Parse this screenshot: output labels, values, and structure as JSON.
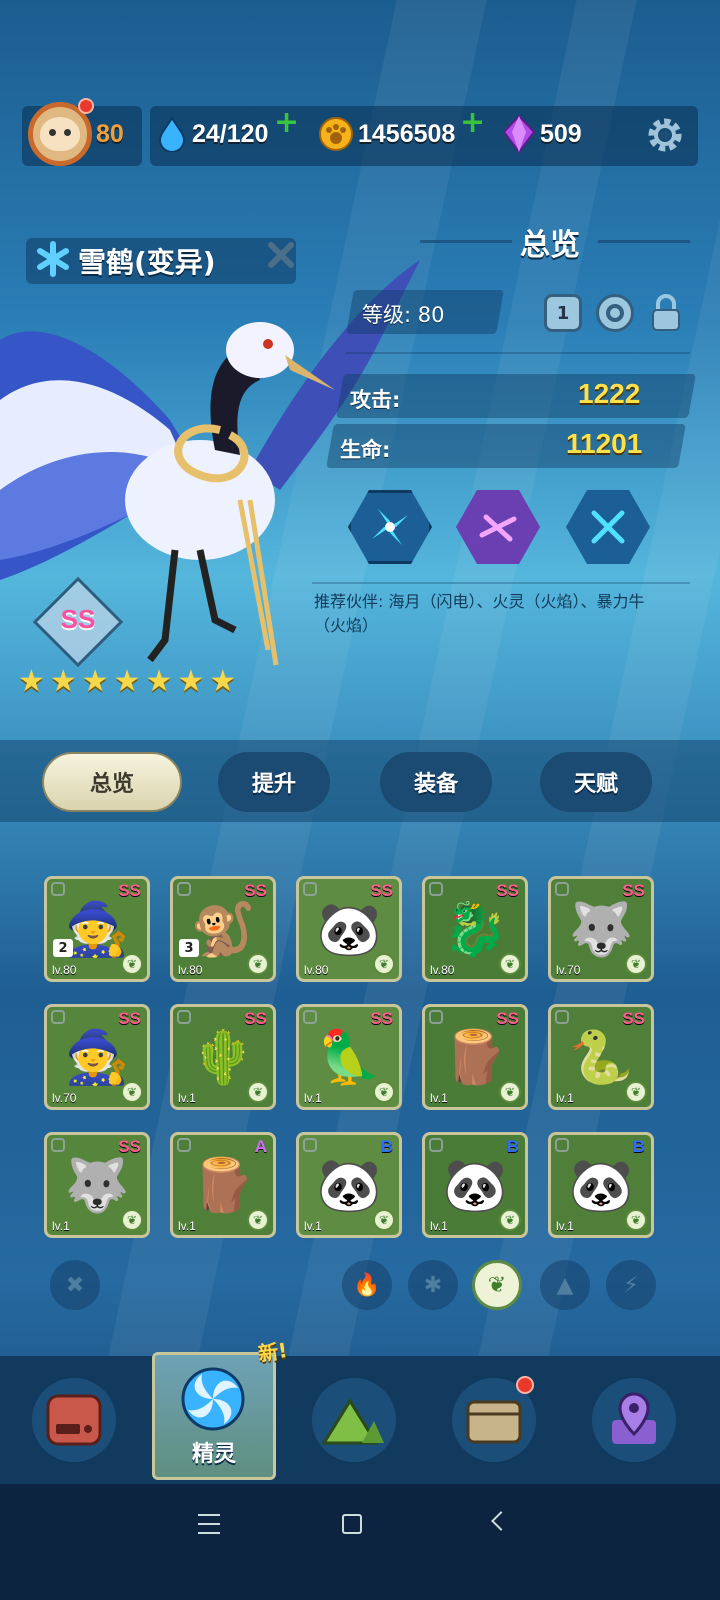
{
  "header": {
    "level": "80",
    "energy": "24/120",
    "coins": "1456508",
    "gems": "509"
  },
  "pet": {
    "name": "雪鹤(变异)",
    "rank": "SS",
    "stars": 7
  },
  "overview": {
    "title": "总览",
    "level_label": "等级: 80",
    "badge_num": "1",
    "attack_label": "攻击:",
    "attack_value": "1222",
    "hp_label": "生命:",
    "hp_value": "11201",
    "recommend": "推荐伙伴: 海月（闪电）、火灵（火焰）、暴力牛（火焰）"
  },
  "tabs": [
    "总览",
    "提升",
    "装备",
    "天赋"
  ],
  "cards": [
    {
      "rank": "SS",
      "lv": "lv.80",
      "num": "2",
      "icon": "🧙"
    },
    {
      "rank": "SS",
      "lv": "lv.80",
      "num": "3",
      "icon": "🐒"
    },
    {
      "rank": "SS",
      "lv": "lv.80",
      "num": "",
      "icon": "🐼"
    },
    {
      "rank": "SS",
      "lv": "lv.80",
      "num": "",
      "icon": "🐉"
    },
    {
      "rank": "SS",
      "lv": "lv.70",
      "num": "",
      "icon": "🐺"
    },
    {
      "rank": "SS",
      "lv": "lv.70",
      "num": "",
      "icon": "🧙"
    },
    {
      "rank": "SS",
      "lv": "lv.1",
      "num": "",
      "icon": "🌵"
    },
    {
      "rank": "SS",
      "lv": "lv.1",
      "num": "",
      "icon": "🦜"
    },
    {
      "rank": "SS",
      "lv": "lv.1",
      "num": "",
      "icon": "🪵"
    },
    {
      "rank": "SS",
      "lv": "lv.1",
      "num": "",
      "icon": "🐍"
    },
    {
      "rank": "SS",
      "lv": "lv.1",
      "num": "",
      "icon": "🐺"
    },
    {
      "rank": "A",
      "lv": "lv.1",
      "num": "",
      "icon": "🪵"
    },
    {
      "rank": "B",
      "lv": "lv.1",
      "num": "",
      "icon": "🐼"
    },
    {
      "rank": "B",
      "lv": "lv.1",
      "num": "",
      "icon": "🐼"
    },
    {
      "rank": "B",
      "lv": "lv.1",
      "num": "",
      "icon": "🐼"
    }
  ],
  "nav": {
    "active_label": "精灵",
    "new_badge": "新!"
  },
  "colors": {
    "gold": "#ffe14a",
    "rank_ss": "#ff5b8d",
    "rank_a": "#d46bff",
    "rank_b": "#2f6dff",
    "leaf": "#3f7f2b"
  }
}
